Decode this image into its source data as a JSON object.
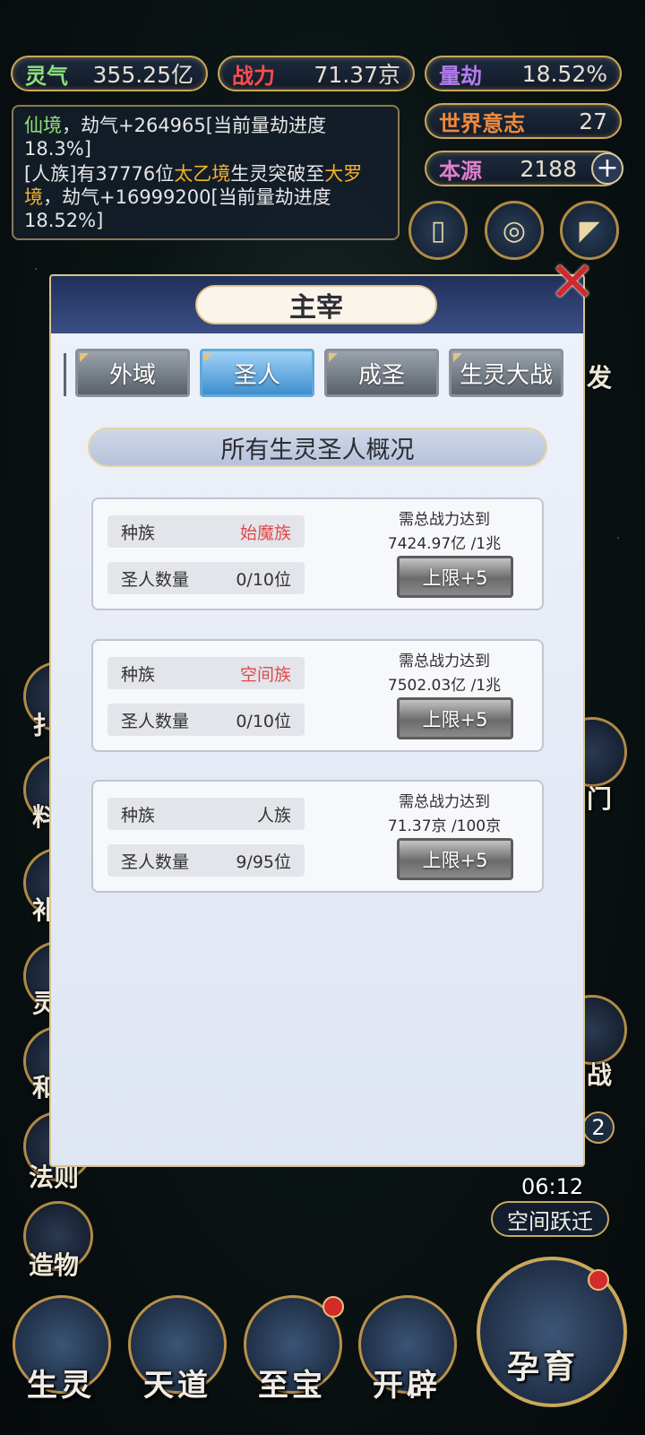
{
  "top_bar": {
    "lingqi": {
      "label": "灵气",
      "value": "355.25亿"
    },
    "zhanli": {
      "label": "战力",
      "value": "71.37京"
    },
    "liangjie": {
      "label": "量劫",
      "value": "18.52%"
    },
    "shijie_yizhi": {
      "label": "世界意志",
      "value": "27"
    },
    "benyuan": {
      "label": "本源",
      "value": "2188"
    }
  },
  "log": {
    "line1_a": "仙境",
    "line1_b": "，劫气+264965[当前量劫进度18.3%]",
    "line2_a": "[人族]有37776位",
    "line2_b": "太乙境",
    "line2_c": "生灵突破至",
    "line2_d": "大罗境",
    "line2_e": "，劫气+16999200[当前量劫进度18.52%]"
  },
  "side": {
    "right_partial_1": "发",
    "right_partial_2": "门",
    "right_partial_3": "战",
    "right_badge_num": "2",
    "timer": "06:12",
    "space_jump": "空间跃迁",
    "left_partial_1": "扌",
    "left_partial_2": "料",
    "left_partial_3": "补",
    "left_partial_4": "灵",
    "left_partial_5": "和",
    "fa_ze": "法则",
    "zao_wu": "造物"
  },
  "dialog": {
    "title": "主宰",
    "tabs": [
      "外域",
      "圣人",
      "成圣",
      "生灵大战"
    ],
    "active_tab": "圣人",
    "subtitle": "所有生灵圣人概况",
    "race_label": "种族",
    "count_label": "圣人数量",
    "req_label": "需总战力达到",
    "cards": [
      {
        "race": "始魔族",
        "race_color": "#e0484a",
        "count": "0/10位",
        "req_value": "7424.97亿 /1兆",
        "button": "上限+5"
      },
      {
        "race": "空间族",
        "race_color": "#e0484a",
        "count": "0/10位",
        "req_value": "7502.03亿 /1兆",
        "button": "上限+5"
      },
      {
        "race": "人族",
        "race_color": "#333333",
        "count": "9/95位",
        "req_value": "71.37京 /100京",
        "button": "上限+5"
      }
    ]
  },
  "bottom_nav": [
    "生灵",
    "天道",
    "至宝",
    "开辟",
    "孕育"
  ],
  "colors": {
    "gold": "#c9a85a",
    "red": "#e0484a",
    "active_tab": "#3e8fce"
  }
}
